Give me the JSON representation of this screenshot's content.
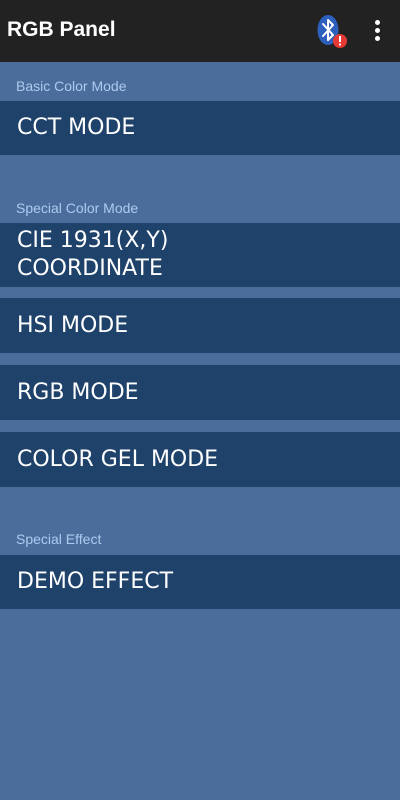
{
  "app_bar": {
    "title": "RGB Panel",
    "bluetooth_icon": "bluetooth-warning-icon",
    "menu_icon": "more-vert-icon"
  },
  "colors": {
    "toolbar": "#222222",
    "background": "#4a6d9c",
    "item": "#1f426b",
    "section_header": "#aecbef",
    "bluetooth": "#2d5fbd",
    "warning": "#e53935"
  },
  "sections": {
    "basic": {
      "header": "Basic Color Mode",
      "items": [
        "CCT MODE"
      ]
    },
    "special": {
      "header": "Special Color Mode",
      "items": [
        "CIE 1931(X,Y)\nCOORDINATE",
        "HSI MODE",
        "RGB MODE",
        "COLOR GEL MODE"
      ]
    },
    "effect": {
      "header": "Special Effect",
      "items": [
        "DEMO EFFECT"
      ]
    }
  }
}
